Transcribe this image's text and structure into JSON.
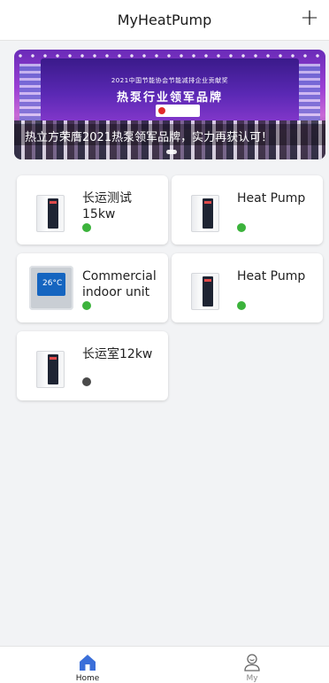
{
  "header": {
    "title": "MyHeatPump",
    "add_label": "+"
  },
  "banner": {
    "line1": "2021中国节能协会节能减排企业贡献奖",
    "line2": "热泵行业领军品牌",
    "caption": "热立方荣膺2021热泵领军品牌，实力再获认可！"
  },
  "devices": [
    {
      "name": "长运测试\n15kw",
      "status": "online",
      "icon": "heat-pump-unit-icon"
    },
    {
      "name": "Heat Pump",
      "status": "online",
      "icon": "heat-pump-unit-icon"
    },
    {
      "name": "Commercial\nindoor unit",
      "status": "online",
      "icon": "thermostat-icon",
      "screen_text": "26°C"
    },
    {
      "name": "Heat Pump",
      "status": "online",
      "icon": "heat-pump-unit-icon"
    },
    {
      "name": "长运室12kw",
      "status": "offline",
      "icon": "heat-pump-unit-icon"
    }
  ],
  "tabbar": {
    "home_label": "Home",
    "my_label": "My"
  },
  "colors": {
    "accent": "#3b6fd9",
    "online": "#3cb33c",
    "offline": "#4a4a4a"
  }
}
